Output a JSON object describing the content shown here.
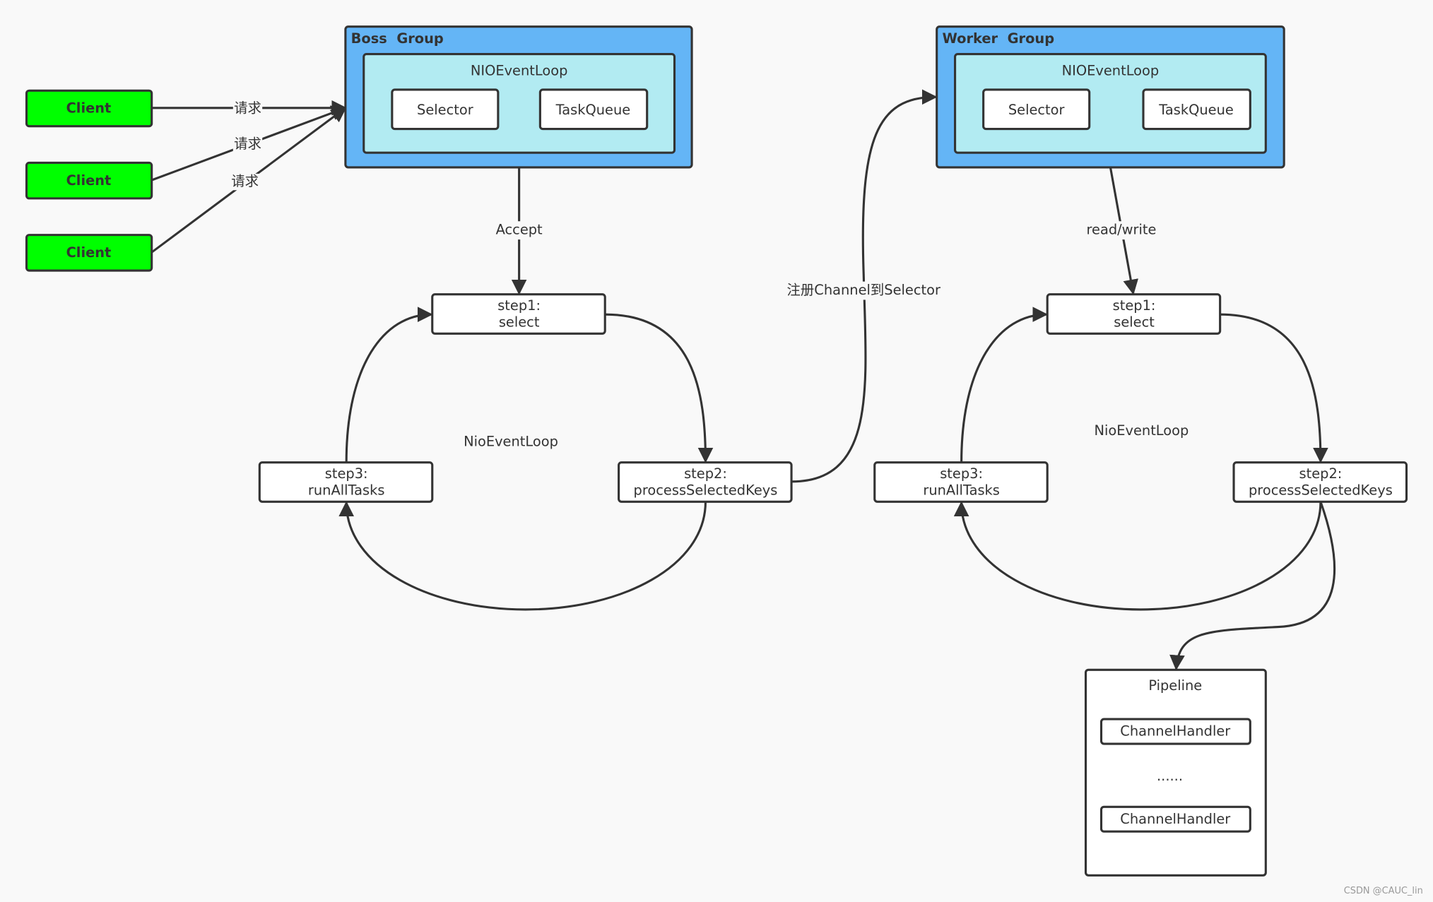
{
  "colors": {
    "client": "#00ff00",
    "group": "#64b5f6",
    "event_loop": "#b2ebf2",
    "box": "#ffffff",
    "line": "#333333",
    "background": "#f9f9f9"
  },
  "clients": [
    "Client",
    "Client",
    "Client"
  ],
  "request_labels": [
    "请求",
    "请求",
    "请求"
  ],
  "boss_group": {
    "title": "Boss  Group",
    "event_loop": "NIOEventLoop",
    "selector": "Selector",
    "task_queue": "TaskQueue"
  },
  "worker_group": {
    "title": "Worker  Group",
    "event_loop": "NIOEventLoop",
    "selector": "Selector",
    "task_queue": "TaskQueue"
  },
  "edges": {
    "accept": "Accept",
    "read_write": "read/write",
    "register": "注册Channel到Selector"
  },
  "boss_loop": {
    "label": "NioEventLoop",
    "step1": [
      "step1:",
      "select"
    ],
    "step2": [
      "step2:",
      "processSelectedKeys"
    ],
    "step3": [
      "step3:",
      "runAllTasks"
    ]
  },
  "worker_loop": {
    "label": "NioEventLoop",
    "step1": [
      "step1:",
      "select"
    ],
    "step2": [
      "step2:",
      "processSelectedKeys"
    ],
    "step3": [
      "step3:",
      "runAllTasks"
    ]
  },
  "pipeline": {
    "title": "Pipeline",
    "handlers": [
      "ChannelHandler",
      "ChannelHandler"
    ],
    "ellipsis": "......"
  },
  "watermark": "CSDN @CAUC_lin"
}
